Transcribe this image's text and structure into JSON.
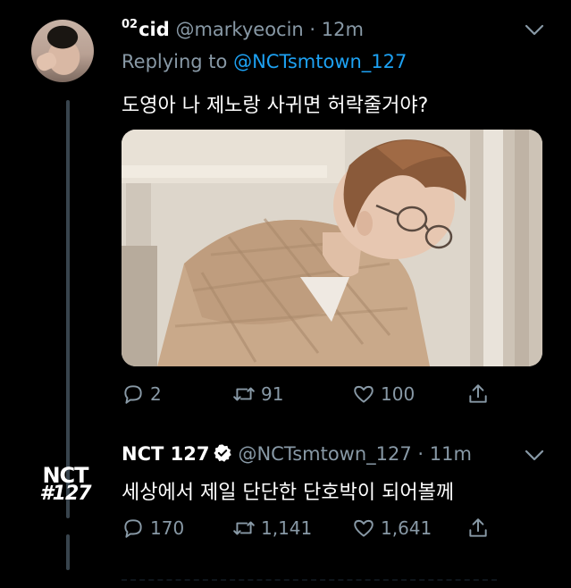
{
  "tweet1": {
    "name_sup": "02",
    "name": "cid",
    "handle_time": "@markyeocin · 12m",
    "replying_prefix": "Replying to",
    "replying_mention": "@NCTsmtown_127",
    "text": "도영아 나 제노랑 사귀면 허락줄거야?",
    "media_description": "photo",
    "replies": "2",
    "retweets": "91",
    "likes": "100"
  },
  "tweet2": {
    "name": "NCT 127",
    "handle_time": "@NCTsmtown_127 · 11m",
    "logo_line1": "NCT",
    "logo_line2": "#127",
    "text": "세상에서 제일 단단한 단호박이 되어볼께",
    "replies": "170",
    "retweets": "1,141",
    "likes": "1,641"
  },
  "colors": {
    "background": "#000000",
    "muted": "#8899a6",
    "link": "#1da1f2",
    "thread_line": "#38444d"
  },
  "icons": [
    "reply-icon",
    "retweet-icon",
    "like-icon",
    "share-icon",
    "chevron-down-icon",
    "verified-icon"
  ]
}
